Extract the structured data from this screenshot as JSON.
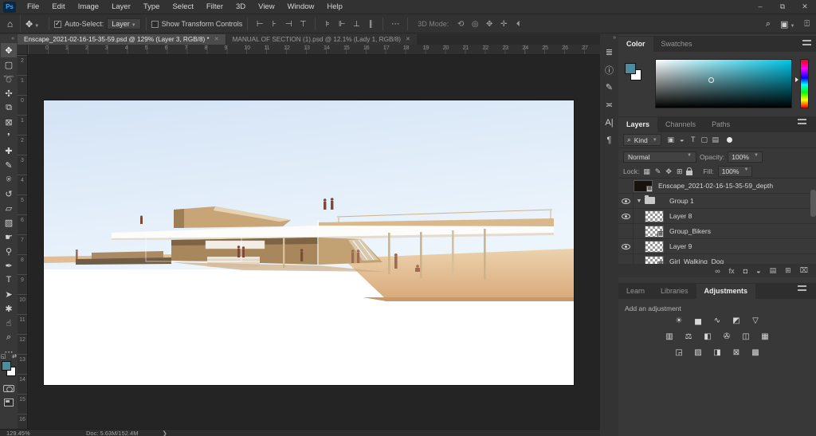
{
  "app": {
    "logo": "Ps",
    "menu": [
      "File",
      "Edit",
      "Image",
      "Layer",
      "Type",
      "Select",
      "Filter",
      "3D",
      "View",
      "Window",
      "Help"
    ],
    "window_controls": [
      {
        "name": "minimize-button",
        "glyph": "–"
      },
      {
        "name": "restore-button",
        "glyph": "⧉"
      },
      {
        "name": "close-button",
        "glyph": "✕"
      }
    ],
    "search_glyph": "⌕",
    "workspace_glyph": "▣",
    "share_glyph": "⍐",
    "home_glyph": "⌂"
  },
  "options_bar": {
    "tool_glyph": "✥",
    "auto_select_label": "Auto-Select:",
    "auto_select_value": "Layer",
    "show_transform_label": "Show Transform Controls",
    "align_icons": [
      {
        "name": "align-left-edges-icon",
        "glyph": "⊢"
      },
      {
        "name": "align-horizontal-centers-icon",
        "glyph": "⊦"
      },
      {
        "name": "align-right-edges-icon",
        "glyph": "⊣"
      },
      {
        "name": "align-top-edges-icon",
        "glyph": "⊤"
      }
    ],
    "distribute_icons": [
      {
        "name": "align-vertical-centers-icon",
        "glyph": "⊧"
      },
      {
        "name": "distribute-horizontal-icon",
        "glyph": "⊩"
      },
      {
        "name": "distribute-vertical-icon",
        "glyph": "⊥"
      },
      {
        "name": "distribute-spacing-icon",
        "glyph": "∥"
      }
    ],
    "more_glyph": "⋯",
    "mode_label": "3D Mode:",
    "mode_icons": [
      {
        "name": "3d-orbit-icon",
        "glyph": "⟲"
      },
      {
        "name": "3d-roll-icon",
        "glyph": "◎"
      },
      {
        "name": "3d-pan-icon",
        "glyph": "✥"
      },
      {
        "name": "3d-slide-icon",
        "glyph": "✛"
      },
      {
        "name": "3d-dolly-icon",
        "glyph": "⏴"
      }
    ]
  },
  "tab_bar": {
    "tabs": [
      {
        "label": "Enscape_2021-02-16-15-35-59.psd @ 129% (Layer 3, RGB/8) *",
        "close": "✕",
        "active": true
      },
      {
        "label": "MANUAL OF SECTION (1).psd @ 12.1% (Lady 1, RGB/8)",
        "close": "✕",
        "active": false
      }
    ]
  },
  "toolbar": {
    "collapse_glyph": "»",
    "foreground_color": "#4e8b9e",
    "background_color": "#ffffff",
    "tools": [
      {
        "name": "move-tool",
        "glyph": "✥",
        "selected": true
      },
      {
        "name": "marquee-tool",
        "glyph": "▢",
        "selected": false
      },
      {
        "name": "lasso-tool",
        "glyph": "➰",
        "selected": false
      },
      {
        "name": "quick-selection-tool",
        "glyph": "✣",
        "selected": false
      },
      {
        "name": "crop-tool",
        "glyph": "⧉",
        "selected": false
      },
      {
        "name": "frame-tool",
        "glyph": "⊠",
        "selected": false
      },
      {
        "name": "eyedropper-tool",
        "glyph": "❜",
        "selected": false
      },
      {
        "name": "healing-brush-tool",
        "glyph": "✚",
        "selected": false
      },
      {
        "name": "brush-tool",
        "glyph": "✎",
        "selected": false
      },
      {
        "name": "clone-stamp-tool",
        "glyph": "⍟",
        "selected": false
      },
      {
        "name": "history-brush-tool",
        "glyph": "↺",
        "selected": false
      },
      {
        "name": "eraser-tool",
        "glyph": "▱",
        "selected": false
      },
      {
        "name": "gradient-tool",
        "glyph": "▨",
        "selected": false
      },
      {
        "name": "smudge-tool",
        "glyph": "☛",
        "selected": false
      },
      {
        "name": "dodge-tool",
        "glyph": "⚲",
        "selected": false
      },
      {
        "name": "pen-tool",
        "glyph": "✒",
        "selected": false
      },
      {
        "name": "type-tool",
        "glyph": "T",
        "selected": false
      },
      {
        "name": "path-selection-tool",
        "glyph": "➤",
        "selected": false
      },
      {
        "name": "shape-tool",
        "glyph": "✱",
        "selected": false
      },
      {
        "name": "hand-tool",
        "glyph": "☝",
        "selected": false
      },
      {
        "name": "zoom-tool",
        "glyph": "⌕",
        "selected": false
      },
      {
        "name": "edit-toolbar",
        "glyph": "⋯",
        "selected": false
      }
    ]
  },
  "rulers": {
    "top": [
      "0",
      "1",
      "2",
      "3",
      "4",
      "5",
      "6",
      "7",
      "8",
      "9",
      "10",
      "11",
      "12",
      "13",
      "14",
      "15",
      "16",
      "17",
      "18",
      "19",
      "20",
      "21",
      "22",
      "23",
      "24",
      "25",
      "26",
      "27"
    ],
    "left": [
      "2",
      "1",
      "0",
      "1",
      "2",
      "3",
      "4",
      "5",
      "6",
      "7",
      "8",
      "9",
      "10",
      "11",
      "12",
      "13",
      "14",
      "15",
      "16"
    ]
  },
  "status_bar": {
    "zoom": "129.45%",
    "doc": "Doc: 5.63M/152.4M",
    "chevron": "❯"
  },
  "dock_strip": {
    "collapse_glyph": "»",
    "icons": [
      {
        "name": "history-icon",
        "glyph": "≣",
        "group_end": false
      },
      {
        "name": "info-icon",
        "glyph": "ⓘ",
        "group_end": true
      },
      {
        "name": "brush-settings-icon",
        "glyph": "✎",
        "group_end": false
      },
      {
        "name": "properties-icon",
        "glyph": "≍",
        "group_end": true
      },
      {
        "name": "character-icon",
        "glyph": "A|",
        "group_end": false
      },
      {
        "name": "paragraph-icon",
        "glyph": "¶",
        "group_end": false
      }
    ]
  },
  "color_panel": {
    "tabs": [
      {
        "label": "Color",
        "active": true
      },
      {
        "label": "Swatches",
        "active": false
      }
    ],
    "foreground_color": "#4e8b9e",
    "background_color": "#ffffff"
  },
  "layers_panel": {
    "tabs": [
      {
        "label": "Layers",
        "active": true
      },
      {
        "label": "Channels",
        "active": false
      },
      {
        "label": "Paths",
        "active": false
      }
    ],
    "filter": {
      "search_glyph": "⌕",
      "kind_label": "Kind",
      "icons": [
        {
          "name": "filter-pixel-layers-icon",
          "glyph": "▣"
        },
        {
          "name": "filter-adjustment-layers-icon",
          "glyph": "◒"
        },
        {
          "name": "filter-type-layers-icon",
          "glyph": "T"
        },
        {
          "name": "filter-shape-layers-icon",
          "glyph": "▢"
        },
        {
          "name": "filter-smart-objects-icon",
          "glyph": "▤"
        }
      ]
    },
    "blend_mode": "Normal",
    "opacity_label": "Opacity:",
    "opacity_value": "100%",
    "lock_label": "Lock:",
    "lock_icons": [
      {
        "name": "lock-transparent-pixels-icon",
        "glyph": "▦"
      },
      {
        "name": "lock-image-pixels-icon",
        "glyph": "✎"
      },
      {
        "name": "lock-position-icon",
        "glyph": "✥"
      },
      {
        "name": "lock-artboard-icon",
        "glyph": "⊞"
      }
    ],
    "fill_label": "Fill:",
    "fill_value": "100%",
    "layers": [
      {
        "name": "Enscape_2021-02-16-15-35-59_depth",
        "visible": false,
        "type": "depth",
        "smart": true,
        "group": false,
        "indent": false
      },
      {
        "name": "Group 1",
        "visible": true,
        "type": "group",
        "smart": false,
        "group": true,
        "indent": false
      },
      {
        "name": "Layer 8",
        "visible": true,
        "type": "checker",
        "smart": false,
        "group": false,
        "indent": true
      },
      {
        "name": "Group_Bikers",
        "visible": false,
        "type": "checker",
        "smart": true,
        "group": false,
        "indent": true
      },
      {
        "name": "Layer 9",
        "visible": true,
        "type": "checker",
        "smart": false,
        "group": false,
        "indent": true
      },
      {
        "name": "Girl_Walking_Dog",
        "visible": false,
        "type": "checker",
        "smart": true,
        "group": false,
        "indent": true
      }
    ],
    "footer_icons": [
      {
        "name": "link-layers-icon",
        "glyph": "∞"
      },
      {
        "name": "layer-style-icon",
        "glyph": "fx"
      },
      {
        "name": "layer-mask-icon",
        "glyph": "◘"
      },
      {
        "name": "adjustment-layer-icon",
        "glyph": "◒"
      },
      {
        "name": "new-group-icon",
        "glyph": "▤"
      },
      {
        "name": "new-layer-icon",
        "glyph": "⊞"
      },
      {
        "name": "delete-layer-icon",
        "glyph": "⌧"
      }
    ]
  },
  "adjustments_panel": {
    "tabs": [
      {
        "label": "Learn",
        "active": false
      },
      {
        "label": "Libraries",
        "active": false
      },
      {
        "label": "Adjustments",
        "active": true
      }
    ],
    "add_label": "Add an adjustment",
    "row1": [
      {
        "name": "brightness-contrast-icon",
        "glyph": "☀"
      },
      {
        "name": "levels-icon",
        "glyph": "▅"
      },
      {
        "name": "curves-icon",
        "glyph": "∿"
      },
      {
        "name": "exposure-icon",
        "glyph": "◩"
      },
      {
        "name": "vibrance-icon",
        "glyph": "▽"
      }
    ],
    "row2": [
      {
        "name": "hue-saturation-icon",
        "glyph": "▥"
      },
      {
        "name": "color-balance-icon",
        "glyph": "⚖"
      },
      {
        "name": "black-white-icon",
        "glyph": "◧"
      },
      {
        "name": "photo-filter-icon",
        "glyph": "✇"
      },
      {
        "name": "channel-mixer-icon",
        "glyph": "◫"
      },
      {
        "name": "color-lookup-icon",
        "glyph": "▦"
      }
    ],
    "row3": [
      {
        "name": "invert-icon",
        "glyph": "◲"
      },
      {
        "name": "posterize-icon",
        "glyph": "▨"
      },
      {
        "name": "threshold-icon",
        "glyph": "◨"
      },
      {
        "name": "selective-color-icon",
        "glyph": "⊠"
      },
      {
        "name": "gradient-map-icon",
        "glyph": "▩"
      }
    ]
  }
}
